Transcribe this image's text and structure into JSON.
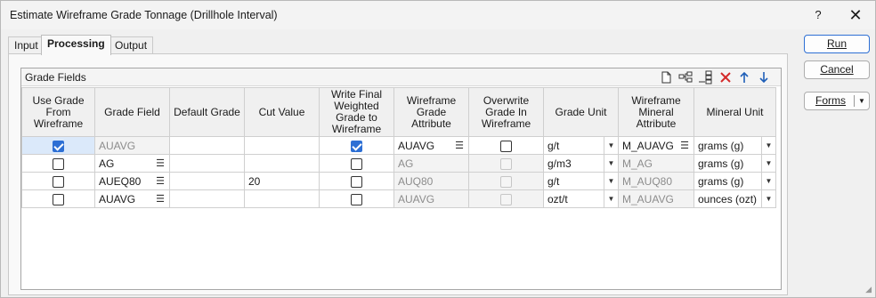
{
  "window": {
    "title": "Estimate Wireframe Grade Tonnage (Drillhole Interval)",
    "help": "?",
    "close": "✕"
  },
  "tabs": [
    {
      "label": "Input"
    },
    {
      "label": "Processing"
    },
    {
      "label": "Output"
    }
  ],
  "group": {
    "title": "Grade Fields"
  },
  "toolbar": [
    "new-file-icon",
    "insert-rows-icon",
    "add-rows-icon",
    "delete-icon",
    "move-up-icon",
    "move-down-icon"
  ],
  "columns": [
    "Use Grade From Wireframe",
    "Grade Field",
    "Default Grade",
    "Cut Value",
    "Write Final Weighted Grade to Wireframe",
    "Wireframe Grade Attribute",
    "Overwrite Grade In Wireframe",
    "Grade Unit",
    "Wireframe Mineral Attribute",
    "Mineral Unit"
  ],
  "rows": [
    {
      "use_grade": true,
      "grade_field": "AUAVG",
      "default_grade": "",
      "cut_value": "",
      "write_final": true,
      "wf_grade_attr": "AUAVG",
      "overwrite": false,
      "grade_unit": "g/t",
      "wf_mineral_attr": "M_AUAVG",
      "mineral_unit": "grams (g)"
    },
    {
      "use_grade": false,
      "grade_field": "AG",
      "default_grade": "",
      "cut_value": "",
      "write_final": false,
      "wf_grade_attr": "AG",
      "overwrite": false,
      "grade_unit": "g/m3",
      "wf_mineral_attr": "M_AG",
      "mineral_unit": "grams (g)"
    },
    {
      "use_grade": false,
      "grade_field": "AUEQ80",
      "default_grade": "",
      "cut_value": "20",
      "write_final": false,
      "wf_grade_attr": "AUQ80",
      "overwrite": false,
      "grade_unit": "g/t",
      "wf_mineral_attr": "M_AUQ80",
      "mineral_unit": "grams (g)"
    },
    {
      "use_grade": false,
      "grade_field": "AUAVG",
      "default_grade": "",
      "cut_value": "",
      "write_final": false,
      "wf_grade_attr": "AUAVG",
      "overwrite": false,
      "grade_unit": "ozt/t",
      "wf_mineral_attr": "M_AUAVG",
      "mineral_unit": "ounces (ozt)"
    }
  ],
  "buttons": {
    "run": "Run",
    "cancel": "Cancel",
    "forms": "Forms"
  }
}
